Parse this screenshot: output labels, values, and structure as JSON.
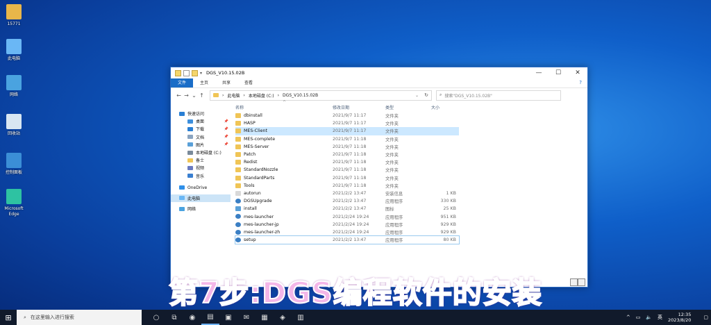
{
  "desktop_icons": [
    {
      "label": "15771",
      "icon": "user-folder-icon",
      "color": "#e8b64a"
    },
    {
      "label": "此电脑",
      "icon": "this-pc-icon",
      "color": "#6ab7f5"
    },
    {
      "label": "网络",
      "icon": "network-icon",
      "color": "#4aa3e0"
    },
    {
      "label": "回收站",
      "icon": "recycle-bin-icon",
      "color": "#d8e6f2"
    },
    {
      "label": "控制面板",
      "icon": "control-panel-icon",
      "color": "#3b8ed6"
    },
    {
      "label": "Microsoft Edge",
      "icon": "edge-icon",
      "color": "#2ec2a2"
    }
  ],
  "window": {
    "title": "DGS_V10.15.02B",
    "controls": {
      "minimize": "—",
      "maximize": "☐",
      "close": "✕"
    },
    "ribbon_tabs": [
      "文件",
      "主页",
      "共享",
      "查看"
    ],
    "help": "?",
    "nav": {
      "back": "←",
      "forward": "→",
      "recent": "⌄",
      "up": "↑"
    },
    "address": {
      "segments": [
        "此电脑",
        "本地磁盘 (C:)",
        "DGS_V10.15.02B"
      ],
      "sep": "›",
      "dropdown": "⌄",
      "refresh": "↻"
    },
    "search_placeholder": "搜索\"DGS_V10.15.02B\"",
    "sidebar": [
      {
        "label": "快速访问",
        "icon": "star-icon",
        "color": "#2a7fd4",
        "pinned": false
      },
      {
        "label": "桌面",
        "icon": "desktop-icon",
        "color": "#3d8fdc",
        "pinned": true
      },
      {
        "label": "下载",
        "icon": "download-icon",
        "color": "#2a7fd4",
        "pinned": true
      },
      {
        "label": "文档",
        "icon": "document-icon",
        "color": "#8aa4c0",
        "pinned": true
      },
      {
        "label": "图片",
        "icon": "pictures-icon",
        "color": "#5aa0d8",
        "pinned": true
      },
      {
        "label": "本地磁盘 (C:)",
        "icon": "drive-icon",
        "color": "#7a8a9a",
        "pinned": false
      },
      {
        "label": "备士",
        "icon": "folder-icon",
        "color": "#f0c556",
        "pinned": false
      },
      {
        "label": "视频",
        "icon": "video-icon",
        "color": "#6a7ac0",
        "pinned": false
      },
      {
        "label": "音乐",
        "icon": "music-icon",
        "color": "#3a7fd0",
        "pinned": false
      },
      {
        "label": "OneDrive",
        "icon": "onedrive-icon",
        "color": "#2f8fe8",
        "pinned": false
      },
      {
        "label": "此电脑",
        "icon": "this-pc-icon",
        "color": "#6ab7f5",
        "pinned": false
      },
      {
        "label": "网络",
        "icon": "network-icon",
        "color": "#4aa3e0",
        "pinned": false
      }
    ],
    "columns": {
      "name": "名称",
      "date": "修改日期",
      "type": "类型",
      "size": "大小"
    },
    "sort_arrow": "^",
    "files": [
      {
        "name": "dbinstall",
        "date": "2021/9/7 11:17",
        "type": "文件夹",
        "size": "",
        "kind": "folder"
      },
      {
        "name": "HASP",
        "date": "2021/9/7 11:17",
        "type": "文件夹",
        "size": "",
        "kind": "folder"
      },
      {
        "name": "MES-Client",
        "date": "2021/9/7 11:17",
        "type": "文件夹",
        "size": "",
        "kind": "folder"
      },
      {
        "name": "MES-complete",
        "date": "2021/9/7 11:18",
        "type": "文件夹",
        "size": "",
        "kind": "folder"
      },
      {
        "name": "MES-Server",
        "date": "2021/9/7 11:18",
        "type": "文件夹",
        "size": "",
        "kind": "folder"
      },
      {
        "name": "Patch",
        "date": "2021/9/7 11:18",
        "type": "文件夹",
        "size": "",
        "kind": "folder"
      },
      {
        "name": "Redist",
        "date": "2021/9/7 11:18",
        "type": "文件夹",
        "size": "",
        "kind": "folder"
      },
      {
        "name": "StandardNozzle",
        "date": "2021/9/7 11:18",
        "type": "文件夹",
        "size": "",
        "kind": "folder"
      },
      {
        "name": "StandardParts",
        "date": "2021/9/7 11:18",
        "type": "文件夹",
        "size": "",
        "kind": "folder"
      },
      {
        "name": "Tools",
        "date": "2021/9/7 11:18",
        "type": "文件夹",
        "size": "",
        "kind": "folder"
      },
      {
        "name": "autorun",
        "date": "2021/2/2 13:47",
        "type": "安装信息",
        "size": "1 KB",
        "kind": "setup-info"
      },
      {
        "name": "DGSUpgrade",
        "date": "2021/2/2 13:47",
        "type": "应用程序",
        "size": "330 KB",
        "kind": "app"
      },
      {
        "name": "install",
        "date": "2021/2/2 13:47",
        "type": "图标",
        "size": "25 KB",
        "kind": "image"
      },
      {
        "name": "mes-launcher",
        "date": "2021/2/24 19:24",
        "type": "应用程序",
        "size": "951 KB",
        "kind": "app"
      },
      {
        "name": "mes-launcher-jp",
        "date": "2021/2/24 19:24",
        "type": "应用程序",
        "size": "929 KB",
        "kind": "app"
      },
      {
        "name": "mes-launcher-zh",
        "date": "2021/2/24 19:24",
        "type": "应用程序",
        "size": "929 KB",
        "kind": "app"
      },
      {
        "name": "setup",
        "date": "2021/2/2 13:47",
        "type": "应用程序",
        "size": "80 KB",
        "kind": "app"
      }
    ],
    "selected_index": 2,
    "focused_index": 16
  },
  "caption": "第7步:DGS编程软件的安装",
  "taskbar": {
    "start": "⊞",
    "search_placeholder": "在这里输入进行搜索",
    "search_icon": "⌕",
    "apps": [
      {
        "name": "task-view-icon",
        "glyph": "○"
      },
      {
        "name": "multitask-icon",
        "glyph": "⧉"
      },
      {
        "name": "edge-icon",
        "glyph": "◉"
      },
      {
        "name": "file-explorer-icon",
        "glyph": "▤"
      },
      {
        "name": "store-icon",
        "glyph": "▣"
      },
      {
        "name": "mail-icon",
        "glyph": "✉"
      },
      {
        "name": "app-icon-1",
        "glyph": "▦"
      },
      {
        "name": "app-icon-2",
        "glyph": "◈"
      },
      {
        "name": "app-icon-3",
        "glyph": "▥"
      }
    ],
    "tray": {
      "chevron": "^",
      "network": "▭",
      "volume": "🔈",
      "ime": "英",
      "time": "12:35",
      "date": "2023/8/20",
      "notify": "▢"
    }
  }
}
